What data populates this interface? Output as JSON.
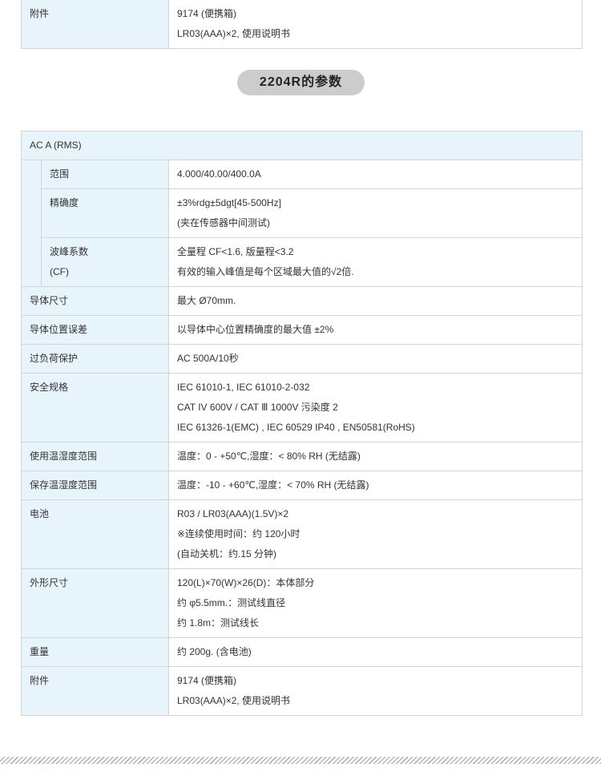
{
  "top_table": {
    "label": "附件",
    "lines": [
      "9174 (便携箱)",
      "LR03(AAA)×2, 使用说明书"
    ]
  },
  "section_title": "2204R的参数",
  "spec": {
    "ac_header": "AC A (RMS)",
    "range_label": "范围",
    "range_value": "4.000/40.00/400.0A",
    "accuracy_label": "精确度",
    "accuracy_lines": [
      "±3%rdg±5dgt[45-500Hz]",
      "(夹在传感器中间测试)"
    ],
    "crest_label_lines": [
      "波峰系数",
      "(CF)"
    ],
    "crest_lines": [
      "全量程 CF<1.6, 版量程<3.2",
      "有效的输入峰值是每个区域最大值的√2倍."
    ],
    "rows": [
      {
        "label": "导体尺寸",
        "lines": [
          "最大 Ø70mm."
        ]
      },
      {
        "label": "导体位置误差",
        "lines": [
          "以导体中心位置精确度的最大值 ±2%"
        ]
      },
      {
        "label": "过负荷保护",
        "lines": [
          "AC 500A/10秒"
        ]
      },
      {
        "label": "安全规格",
        "lines": [
          "IEC 61010-1, IEC 61010-2-032",
          "CAT IV 600V / CAT Ⅲ 1000V 污染度 2",
          "IEC 61326-1(EMC) , IEC 60529 IP40 , EN50581(RoHS)"
        ]
      },
      {
        "label": "使用温湿度范围",
        "lines": [
          "温度：0 - +50℃,湿度：< 80% RH (无结露)"
        ]
      },
      {
        "label": "保存温湿度范围",
        "lines": [
          "温度：-10 - +60℃,湿度：< 70% RH (无结露)"
        ]
      },
      {
        "label": "电池",
        "lines": [
          "R03 / LR03(AAA)(1.5V)×2",
          "※连续使用时间：约 120小时",
          "(自动关机：约.15 分钟)"
        ]
      },
      {
        "label": "外形尺寸",
        "lines": [
          "120(L)×70(W)×26(D)：本体部分",
          "约 φ5.5mm.：测试线直径",
          "约 1.8m：测试线长"
        ]
      },
      {
        "label": "重量",
        "lines": [
          "约 200g. (含电池)"
        ]
      },
      {
        "label": "附件",
        "lines": [
          "9174 (便携箱)",
          "LR03(AAA)×2, 使用说明书"
        ]
      }
    ]
  }
}
